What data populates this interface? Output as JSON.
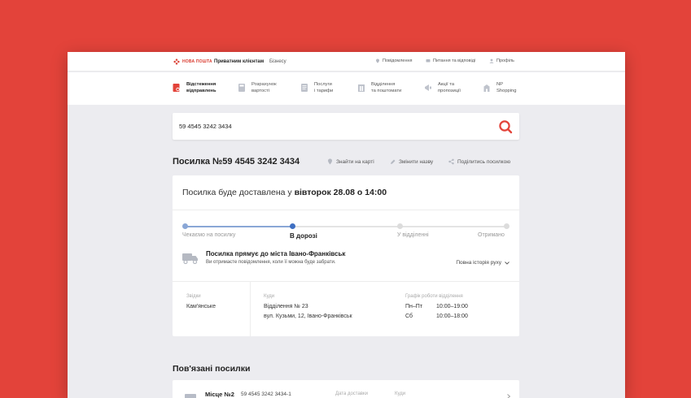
{
  "topbar": {
    "logo_text": "НОВА ПОШТА",
    "nav": [
      "Приватним клієнтам",
      "Бізнесу"
    ],
    "right": [
      {
        "icon": "location-pin-icon",
        "label": "Повідомлення"
      },
      {
        "icon": "chat-icon",
        "label": "Питання та відповіді"
      },
      {
        "icon": "user-icon",
        "label": "Профіль"
      }
    ]
  },
  "mainnav": [
    {
      "icon": "tracking-icon",
      "line1": "Відстеження",
      "line2": "відправлень"
    },
    {
      "icon": "calculator-icon",
      "line1": "Розрахунок",
      "line2": "вартості"
    },
    {
      "icon": "document-icon",
      "line1": "Послуги",
      "line2": "і тарифи"
    },
    {
      "icon": "building-icon",
      "line1": "Відділення",
      "line2": "та поштомати"
    },
    {
      "icon": "megaphone-icon",
      "line1": "Акції та",
      "line2": "пропозиції"
    },
    {
      "icon": "shop-icon",
      "line1": "NP",
      "line2": "Shopping"
    }
  ],
  "search": {
    "value": "59 4545 3242 3434"
  },
  "parcel": {
    "title": "Посилка №59 4545 3242 3434",
    "actions": [
      {
        "icon": "map-pin-icon",
        "label": "Знайти на карті"
      },
      {
        "icon": "pencil-icon",
        "label": "Змінити назву"
      },
      {
        "icon": "share-icon",
        "label": "Поділитись посилкою"
      }
    ]
  },
  "delivery": {
    "prefix": "Посилка буде доставлена у",
    "date": "вівторок 28.08 о 14:00"
  },
  "steps": [
    "Чекаємо на посилку",
    "В дорозі",
    "У відділенні",
    "Отримано"
  ],
  "status": {
    "title": "Посилка прямує до міста Івано-Франківськ",
    "subtitle": "Ви отримаєте повідомлення, коли її можна буде забрати.",
    "history": "Повна історія руху"
  },
  "info": {
    "from_label": "Звідки",
    "from_value": "Кам'янське",
    "to_label": "Куди",
    "to_line1": "Відділення № 23",
    "to_line2": "вул. Кузьми, 12, Івано-Франківськ",
    "schedule_label": "Графік роботи відділення",
    "schedule": [
      {
        "days": "Пн–Пт",
        "hours": "10:00–19:00"
      },
      {
        "days": "Сб",
        "hours": "10:00–18:00"
      }
    ]
  },
  "related": {
    "title": "Пов'язані посилки",
    "item": {
      "name": "Місце №2",
      "number": "59 4545 3242 3434-1",
      "date_label": "Дата доставки",
      "to_label": "Куди"
    }
  },
  "colors": {
    "brand": "#e3433a",
    "accent": "#3f6fc2",
    "progress": "#8aa7d6"
  }
}
